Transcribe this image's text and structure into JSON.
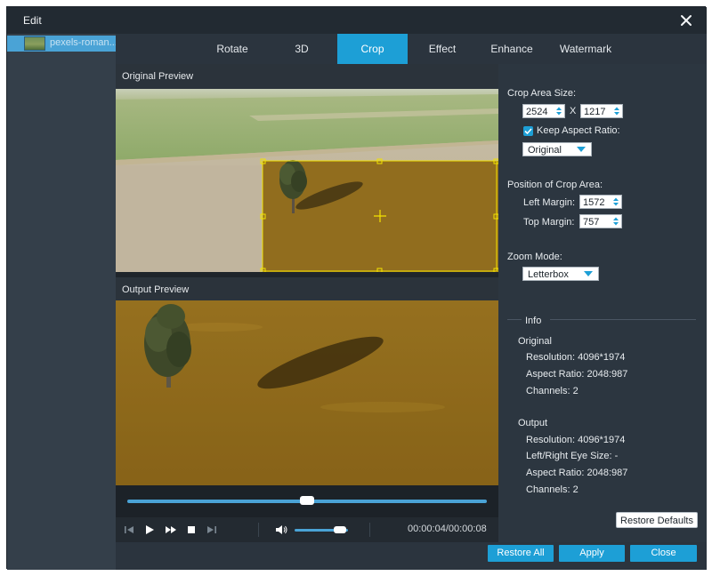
{
  "window": {
    "title": "Edit"
  },
  "sidebar": {
    "items": [
      {
        "label": "pexels-roman..."
      }
    ]
  },
  "tabs": [
    {
      "label": "Rotate",
      "active": false
    },
    {
      "label": "3D",
      "active": false
    },
    {
      "label": "Crop",
      "active": true
    },
    {
      "label": "Effect",
      "active": false
    },
    {
      "label": "Enhance",
      "active": false
    },
    {
      "label": "Watermark",
      "active": false
    }
  ],
  "preview": {
    "original_label": "Original Preview",
    "output_label": "Output Preview",
    "playback_progress": 0.5,
    "volume_level": 0.85,
    "timecode": "00:00:04/00:00:08"
  },
  "crop": {
    "area_size_label": "Crop Area Size:",
    "width": "2524",
    "times": "X",
    "height": "1217",
    "keep_aspect_label": "Keep Aspect Ratio:",
    "keep_aspect_checked": true,
    "aspect_option": "Original",
    "position_label": "Position of Crop Area:",
    "left_margin_label": "Left Margin:",
    "left_margin": "1572",
    "top_margin_label": "Top Margin:",
    "top_margin": "757",
    "zoom_label": "Zoom Mode:",
    "zoom_option": "Letterbox"
  },
  "info": {
    "header": "Info",
    "original_header": "Original",
    "original_resolution": "Resolution: 4096*1974",
    "original_aspect": "Aspect Ratio: 2048:987",
    "original_channels": "Channels: 2",
    "output_header": "Output",
    "output_resolution": "Resolution: 4096*1974",
    "output_eye": "Left/Right Eye Size: -",
    "output_aspect": "Aspect Ratio: 2048:987",
    "output_channels": "Channels: 2"
  },
  "buttons": {
    "restore_defaults": "Restore Defaults",
    "restore_all": "Restore All",
    "apply": "Apply",
    "close": "Close"
  },
  "colors": {
    "accent": "#1d9fd6",
    "crop_frame": "#f2e200",
    "panel_bg": "#2c3640"
  },
  "icons": [
    "close-icon",
    "video-thumbnail",
    "skip-back-icon",
    "play-icon",
    "fast-forward-icon",
    "stop-icon",
    "skip-forward-icon",
    "volume-icon",
    "checkmark-icon",
    "spinner-arrows-icon",
    "dropdown-caret-icon"
  ]
}
